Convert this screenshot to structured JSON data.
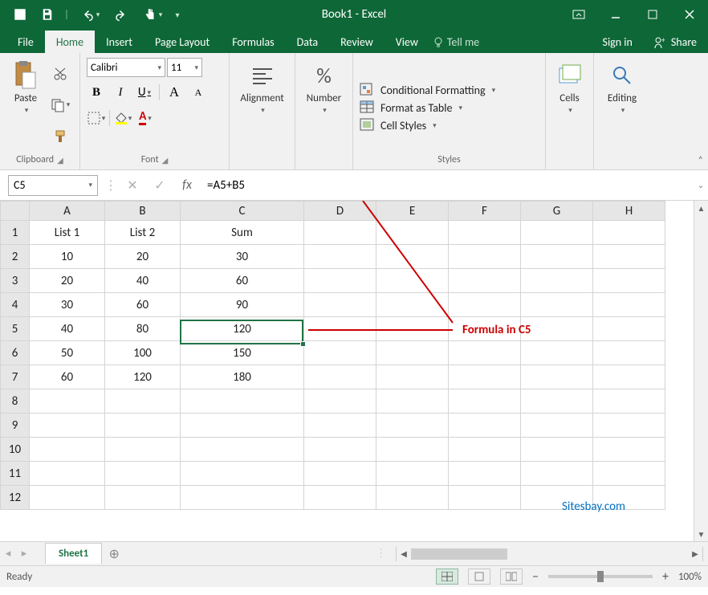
{
  "colors": {
    "brand": "#0e6737",
    "accent": "#217346",
    "annotation": "#c00000",
    "link": "#0070c0"
  },
  "titlebar": {
    "title": "Book1 - Excel",
    "qat": {
      "save": "Save",
      "undo": "Undo",
      "redo": "Redo",
      "touch": "Touch/Mouse Mode"
    }
  },
  "tabs": {
    "file": "File",
    "items": [
      "Home",
      "Insert",
      "Page Layout",
      "Formulas",
      "Data",
      "Review",
      "View"
    ],
    "active": "Home",
    "tell_me": "Tell me",
    "sign_in": "Sign in",
    "share": "Share"
  },
  "ribbon": {
    "clipboard": {
      "label": "Clipboard",
      "paste": "Paste"
    },
    "font": {
      "label": "Font",
      "name": "Calibri",
      "size": "11",
      "bold": "B",
      "italic": "I",
      "underline": "U",
      "grow": "A",
      "shrink": "A"
    },
    "alignment": {
      "label": "Alignment"
    },
    "number": {
      "label": "Number"
    },
    "styles": {
      "label": "Styles",
      "conditional": "Conditional Formatting",
      "table": "Format as Table",
      "cell_styles": "Cell Styles"
    },
    "cells": {
      "label": "Cells"
    },
    "editing": {
      "label": "Editing"
    }
  },
  "formula_bar": {
    "name_box": "C5",
    "formula": "=A5+B5"
  },
  "grid": {
    "columns": [
      "A",
      "B",
      "C",
      "D",
      "E",
      "F",
      "G",
      "H"
    ],
    "rows": [
      "1",
      "2",
      "3",
      "4",
      "5",
      "6",
      "7",
      "8",
      "9",
      "10",
      "11",
      "12"
    ],
    "selection": {
      "col": "C",
      "row": "5"
    },
    "data": {
      "1": {
        "A": "List 1",
        "B": "List 2",
        "C": "Sum"
      },
      "2": {
        "A": "10",
        "B": "20",
        "C": "30"
      },
      "3": {
        "A": "20",
        "B": "40",
        "C": "60"
      },
      "4": {
        "A": "30",
        "B": "60",
        "C": "90"
      },
      "5": {
        "A": "40",
        "B": "80",
        "C": "120"
      },
      "6": {
        "A": "50",
        "B": "100",
        "C": "150"
      },
      "7": {
        "A": "60",
        "B": "120",
        "C": "180"
      }
    }
  },
  "annotation": {
    "text": "Formula in C5"
  },
  "watermark": {
    "text": "Sitesbay.com"
  },
  "sheets": {
    "active": "Sheet1"
  },
  "statusbar": {
    "ready": "Ready",
    "zoom": "100%"
  }
}
